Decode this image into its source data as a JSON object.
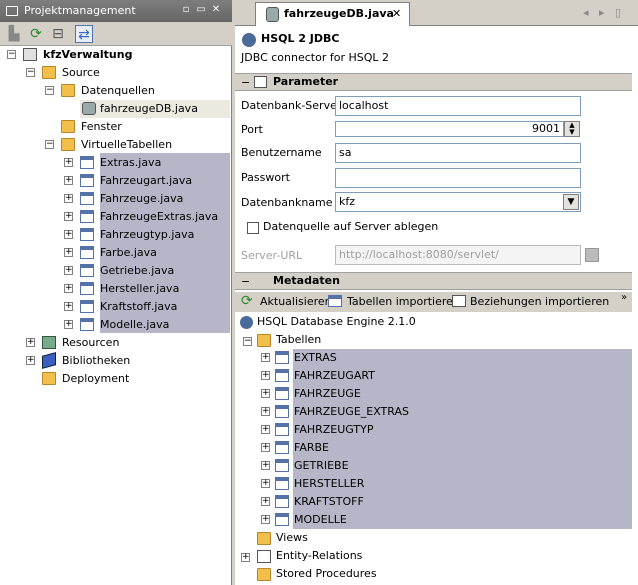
{
  "left_panel": {
    "title": "Projektmanagement"
  },
  "left_tree": {
    "project": "kfzVerwaltung",
    "source": "Source",
    "datenquellen": "Datenquellen",
    "db_file": "fahrzeugeDB.java",
    "fenster": "Fenster",
    "virtuelle": "VirtuelleTabellen",
    "items": [
      "Extras.java",
      "Fahrzeugart.java",
      "Fahrzeuge.java",
      "FahrzeugeExtras.java",
      "Fahrzeugtyp.java",
      "Farbe.java",
      "Getriebe.java",
      "Hersteller.java",
      "Kraftstoff.java",
      "Modelle.java"
    ],
    "resourcen": "Resourcen",
    "bibliotheken": "Bibliotheken",
    "deployment": "Deployment"
  },
  "editor": {
    "tab": "fahrzeugeDB.java",
    "driver_title": "HSQL 2 JDBC",
    "driver_desc": "JDBC connector for HSQL 2"
  },
  "parameter": {
    "header": "Parameter",
    "server_label": "Datenbank-Server",
    "server_value": "localhost",
    "port_label": "Port",
    "port_value": "9001",
    "user_label": "Benutzername",
    "user_value": "sa",
    "pass_label": "Passwort",
    "pass_value": "",
    "dbname_label": "Datenbankname",
    "dbname_value": "kfz",
    "checkbox_label": "Datenquelle auf Server ablegen",
    "url_label": "Server-URL",
    "url_value": "http://localhost:8080/servlet/"
  },
  "metadaten": {
    "header": "Metadaten",
    "btn_refresh": "Aktualisieren",
    "btn_import_tables": "Tabellen importieren",
    "btn_import_rel": "Beziehungen importieren",
    "engine": "HSQL Database Engine 2.1.0",
    "tabellen": "Tabellen",
    "tables": [
      "EXTRAS",
      "FAHRZEUGART",
      "FAHRZEUGE",
      "FAHRZEUGE_EXTRAS",
      "FAHRZEUGTYP",
      "FARBE",
      "GETRIEBE",
      "HERSTELLER",
      "KRAFTSTOFF",
      "MODELLE"
    ],
    "views": "Views",
    "entity": "Entity-Relations",
    "stored": "Stored Procedures"
  }
}
